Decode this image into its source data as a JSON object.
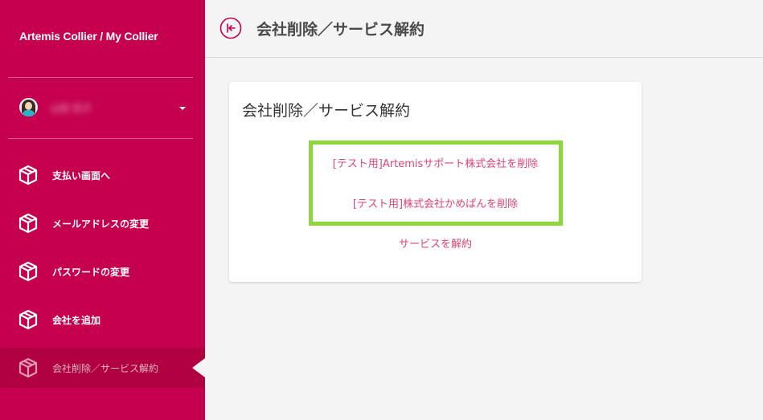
{
  "app": {
    "brand": "Artemis Collier / My Collier"
  },
  "user": {
    "name": "山田 花子"
  },
  "sidebar": {
    "items": [
      {
        "label": "支払い画面へ",
        "icon": "box-icon"
      },
      {
        "label": "メールアドレスの変更",
        "icon": "box-icon"
      },
      {
        "label": "パスワードの変更",
        "icon": "box-icon"
      },
      {
        "label": "会社を追加",
        "icon": "box-icon"
      },
      {
        "label": "会社削除／サービス解約",
        "icon": "box-icon",
        "active": true
      }
    ]
  },
  "header": {
    "title": "会社削除／サービス解約",
    "back_icon": "back-arrow-icon"
  },
  "card": {
    "title": "会社削除／サービス解約",
    "links": [
      "[テスト用]Artemisサポート株式会社を削除",
      "[テスト用]株式会社かめぱんを削除",
      "サービスを解約"
    ]
  },
  "colors": {
    "sidebar": "#c4004f",
    "link": "#e5436f",
    "highlight": "#8dd63c",
    "background": "#f4f4f4"
  }
}
